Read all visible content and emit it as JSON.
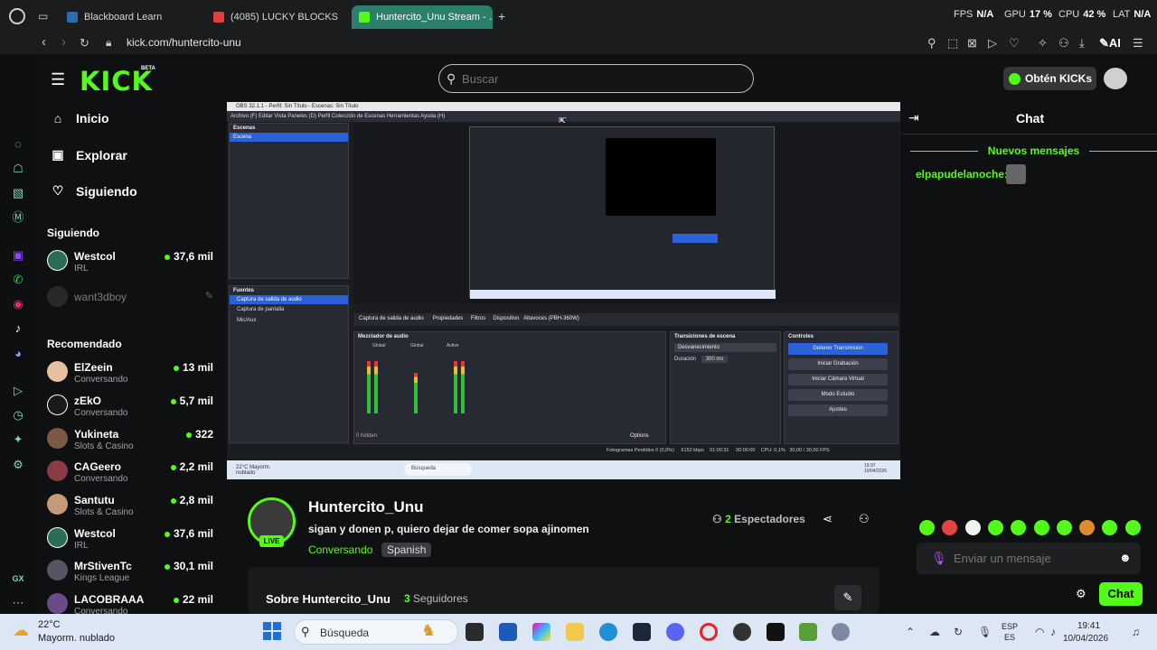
{
  "browser": {
    "tabs": [
      {
        "label": "Blackboard Learn",
        "color": "#2b6cb0"
      },
      {
        "label": "(4085) LUCKY BLOCKS |",
        "color": "#e53e3e"
      },
      {
        "label": "Huntercito_Unu Stream - …",
        "color": "#53fc18"
      }
    ],
    "new_tab": "+",
    "url": "kick.com/huntercito-unu",
    "hud": {
      "fps_label": "FPS",
      "fps_value": "N/A",
      "gpu_label": "GPU",
      "gpu_value": "17 %",
      "cpu_label": "CPU",
      "cpu_value": "42 %",
      "lat_label": "LAT",
      "lat_value": "N/A"
    },
    "ai_label": "AI"
  },
  "kick": {
    "logo": "KICK",
    "beta": "BETA",
    "search_placeholder": "Buscar",
    "get_kicks": "Obtén KICKs",
    "nav": [
      {
        "label": "Inicio",
        "icon": "home-icon"
      },
      {
        "label": "Explorar",
        "icon": "compass-icon"
      },
      {
        "label": "Siguiendo",
        "icon": "heart-icon"
      }
    ],
    "following_title": "Siguiendo",
    "following": [
      {
        "name": "Westcol",
        "category": "IRL",
        "viewers": "37,6 mil"
      },
      {
        "name": "want3dboy",
        "category": "",
        "viewers": ""
      }
    ],
    "recommended_title": "Recomendado",
    "recommended": [
      {
        "name": "ElZeein",
        "category": "Conversando",
        "viewers": "13 mil"
      },
      {
        "name": "zEkO",
        "category": "Conversando",
        "viewers": "5,7 mil"
      },
      {
        "name": "Yukineta",
        "category": "Slots & Casino",
        "viewers": "322"
      },
      {
        "name": "CAGeero",
        "category": "Conversando",
        "viewers": "2,2 mil"
      },
      {
        "name": "Santutu",
        "category": "Slots & Casino",
        "viewers": "2,8 mil"
      },
      {
        "name": "Westcol",
        "category": "IRL",
        "viewers": "37,6 mil"
      },
      {
        "name": "MrStivenTc",
        "category": "Kings League",
        "viewers": "30,1 mil"
      },
      {
        "name": "LACOBRAAA",
        "category": "Conversando",
        "viewers": "22 mil"
      }
    ]
  },
  "obs": {
    "title": "OBS 32.1.1 - Perfil: Sin Título - Escenas: Sin Título",
    "menu": "Archivo (F)   Editar   Vista   Paneles (D)   Perfil   Colección de Escenas   Herramientas   Ayuda (H)",
    "scenes_title": "Escenas",
    "scene_item": "Escena",
    "sources_title": "Fuentes",
    "sources": [
      "Captura de salida de audio",
      "Captura de pantalla",
      "Mic/Aux"
    ],
    "props_bar": "Captura de salida de audio      Propiedades     Filtros     Dispositivo   Altavoces (PBH-360W)",
    "mixer_title": "Mezclador de audio",
    "mixer_channels": [
      "Global",
      "Global",
      "Active"
    ],
    "transitions_title": "Transiciones de escena",
    "transition": "Desvanecimiento",
    "duration_label": "Duración",
    "duration_value": "300 ms",
    "controls_title": "Controles",
    "controls": [
      "Detener Transmisión",
      "Iniciar Grabación",
      "Iniciar Cámara Virtual",
      "Modo Estudio",
      "Ajustes"
    ],
    "hidden_label": "0 hidden",
    "options_label": "Options",
    "status": "Fotogramas Perdidos 0 (0,0%)     6152 kbps    01:00:31     00:00:00    CPU: 0,1%   30,00 / 30,00 FPS",
    "inner_taskbar_weather": "22°C Mayorm. nublado",
    "inner_taskbar_search": "Búsqueda",
    "inner_clock": "19:37 10/04/2026"
  },
  "stream": {
    "name": "Huntercito_Unu",
    "title": "sigan y donen p, quiero dejar de comer sopa ajinomen",
    "category": "Conversando",
    "language": "Spanish",
    "live": "LIVE",
    "viewers_count": "2",
    "viewers_label": "Espectadores",
    "about": "Sobre Huntercito_Unu",
    "followers_count": "3",
    "followers_label": "Seguidores"
  },
  "chat": {
    "title": "Chat",
    "new_messages": "Nuevos mensajes",
    "messages": [
      {
        "user": "elpapudelanoche:"
      }
    ],
    "input_placeholder": "Enviar un mensaje",
    "send": "Chat",
    "emote_colors": [
      "#53fc18",
      "#e04444",
      "#f2f2f2",
      "#53fc18",
      "#53fc18",
      "#53fc18",
      "#53fc18",
      "#e08a2e",
      "#53fc18",
      "#53fc18"
    ]
  },
  "taskbar": {
    "weather_temp": "22°C",
    "weather_desc": "Mayorm. nublado",
    "search": "Búsqueda",
    "lang": "ESP",
    "lang_sub": "ES",
    "time": "19:41",
    "date": "10/04/2026"
  }
}
